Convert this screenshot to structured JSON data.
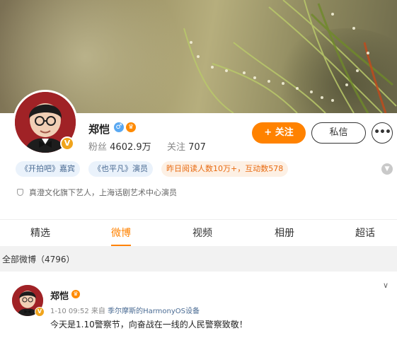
{
  "profile": {
    "name": "郑恺",
    "gender_symbol": "♂",
    "fans_label": "粉丝",
    "fans_count": "4602.9万",
    "following_label": "关注",
    "following_count": "707",
    "verified_mark": "V"
  },
  "actions": {
    "follow_label": "+ 关注",
    "message_label": "私信",
    "more_label": "•••"
  },
  "tags": [
    {
      "text": "《开拍吧》嘉宾",
      "style": "blue"
    },
    {
      "text": "《也平凡》演员",
      "style": "blue"
    },
    {
      "text": "昨日阅读人数10万+，互动数578",
      "style": "orange"
    }
  ],
  "description": "真澄文化旗下艺人，上海话剧艺术中心演员",
  "tabs": [
    {
      "label": "精选",
      "active": false
    },
    {
      "label": "微博",
      "active": true
    },
    {
      "label": "视频",
      "active": false
    },
    {
      "label": "相册",
      "active": false
    },
    {
      "label": "超话",
      "active": false
    }
  ],
  "section": {
    "label": "全部微博（4796）"
  },
  "post": {
    "author": "郑恺",
    "time": "1-10 09:52",
    "source_prefix": "来自",
    "source": "季尔摩斯的HarmonyOS设备",
    "text": "今天是1.10警察节，向奋战在一线的人民警察致敬！"
  },
  "colors": {
    "accent": "#ff8200",
    "tag_blue_bg": "#eaf2fb",
    "tag_orange_bg": "#fdf0e4",
    "avatar_bg": "#a02226"
  },
  "icons": [
    "gender-male-icon",
    "crown-icon",
    "verified-v-icon",
    "shield-icon",
    "expand-chevron-icon",
    "chevron-down-icon"
  ]
}
